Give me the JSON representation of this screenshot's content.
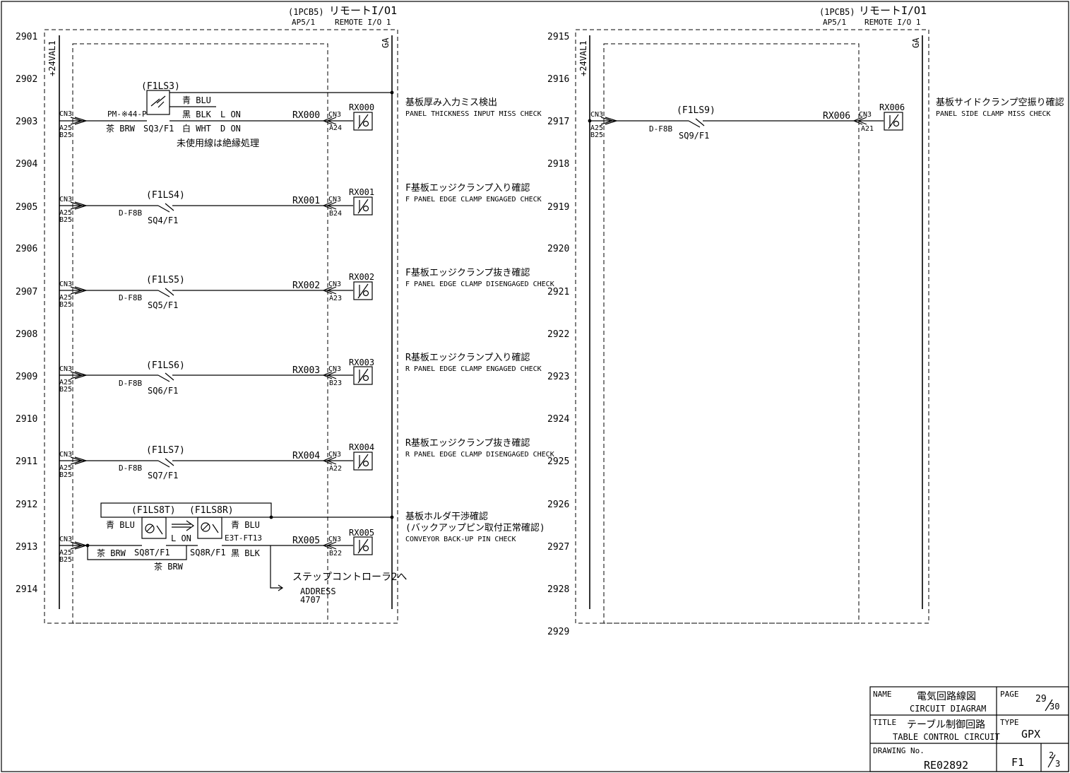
{
  "header_left": {
    "board": "(1PCB5)",
    "title": "リモートI/O1",
    "ap": "AP5/1",
    "remote": "REMOTE I/O 1"
  },
  "header_right": {
    "board": "(1PCB5)",
    "title": "リモートI/O1",
    "ap": "AP5/1",
    "remote": "REMOTE I/O 1"
  },
  "power_label": "+24VAL1",
  "ground_label": "GA",
  "row_numbers_left": [
    "2901",
    "2902",
    "2903",
    "2904",
    "2905",
    "2906",
    "2907",
    "2908",
    "2909",
    "2910",
    "2911",
    "2912",
    "2913",
    "2914"
  ],
  "row_numbers_right": [
    "2915",
    "2916",
    "2917",
    "2918",
    "2919",
    "2920",
    "2921",
    "2922",
    "2923",
    "2924",
    "2925",
    "2926",
    "2927",
    "2928",
    "2929"
  ],
  "cn_label": "CN3",
  "a25": "A25",
  "b25": "B25",
  "io_symbol_label": "I/O",
  "circuits": [
    {
      "device": "(F1LS3)",
      "model": "PM-※44-P",
      "sq": "SQ3/F1",
      "rx": "RX000",
      "pin": "A24",
      "desc_jp": "基板厚み入力ミス検出",
      "desc_en": "PANEL THICKNESS INPUT MISS CHECK",
      "wire1": "青 BLU",
      "wire2": "黒 BLK",
      "wire2_note": "L ON",
      "wire3": "白 WHT",
      "wire3_note": "D ON",
      "wire_brw": "茶 BRW",
      "unused_note": "未使用線は絶縁処理"
    },
    {
      "device": "(F1LS4)",
      "model": "D-F8B",
      "sq": "SQ4/F1",
      "rx": "RX001",
      "pin": "B24",
      "desc_jp": "F基板エッジクランプ入り確認",
      "desc_en": "F PANEL EDGE CLAMP ENGAGED CHECK"
    },
    {
      "device": "(F1LS5)",
      "model": "D-F8B",
      "sq": "SQ5/F1",
      "rx": "RX002",
      "pin": "A23",
      "desc_jp": "F基板エッジクランプ抜き確認",
      "desc_en": "F PANEL EDGE CLAMP DISENGAGED CHECK"
    },
    {
      "device": "(F1LS6)",
      "model": "D-F8B",
      "sq": "SQ6/F1",
      "rx": "RX003",
      "pin": "B23",
      "desc_jp": "R基板エッジクランプ入り確認",
      "desc_en": "R PANEL EDGE CLAMP ENGAGED CHECK"
    },
    {
      "device": "(F1LS7)",
      "model": "D-F8B",
      "sq": "SQ7/F1",
      "rx": "RX004",
      "pin": "A22",
      "desc_jp": "R基板エッジクランプ抜き確認",
      "desc_en": "R PANEL EDGE CLAMP DISENGAGED CHECK"
    },
    {
      "device_t": "(F1LS8T)",
      "device_r": "(F1LS8R)",
      "sq_t": "SQ8T/F1",
      "sq_r": "SQ8R/F1",
      "model": "E3T-FT13",
      "rx": "RX005",
      "pin": "B22",
      "wire_blu": "青 BLU",
      "wire_blk": "黒 BLK",
      "wire_brw": "茶 BRW",
      "lon": "L ON",
      "desc_jp": "基板ホルダ干渉確認",
      "desc_jp2": "(バックアップピン取付正常確認)",
      "desc_en": "CONVEYOR BACK-UP PIN CHECK",
      "step_note": "ステップコントローラ2へ",
      "address_label": "ADDRESS",
      "address_value": "4707"
    },
    {
      "device": "(F1LS9)",
      "model": "D-F8B",
      "sq": "SQ9/F1",
      "rx": "RX006",
      "pin": "A21",
      "desc_jp": "基板サイドクランプ空振り確認",
      "desc_en": "PANEL SIDE CLAMP MISS CHECK"
    }
  ],
  "title_block": {
    "name_label": "NAME",
    "name_jp": "電気回路線図",
    "name_en": "CIRCUIT DIAGRAM",
    "page_label": "PAGE",
    "page_num": "29",
    "page_total": "30",
    "title_label": "TITLE",
    "title_jp": "テーブル制御回路",
    "title_en": "TABLE CONTROL CIRCUIT",
    "type_label": "TYPE",
    "type_value": "GPX",
    "drawing_label": "DRAWING No.",
    "drawing_value": "RE02892",
    "sheet": "F1",
    "sheet_num": "2",
    "sheet_total": "3"
  }
}
